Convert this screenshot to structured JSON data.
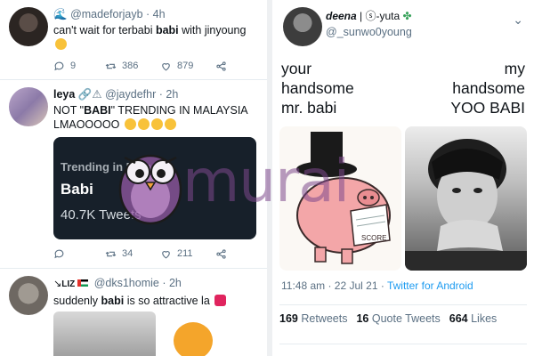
{
  "left_tweets": [
    {
      "name": "",
      "handle": "@madeforjayb · 4h",
      "body_pre": "can't wait for terbabi ",
      "body_bold": "babi",
      "body_post": " with jinyoung",
      "replies": "9",
      "retweets": "386",
      "likes": "879"
    },
    {
      "name": "leya",
      "handle": "@jaydefhr · 2h",
      "body_pre": "NOT \"",
      "body_bold": "BABI",
      "body_post": "\" TRENDING IN MALAYSIA LMAOOOOO",
      "trend_title": "Trending in Malaysia",
      "trend_word": "Babi",
      "trend_count": "40.7K Tweets",
      "retweets": "34",
      "likes": "211"
    },
    {
      "name": "LIZ",
      "handle": "@dks1homie · 2h",
      "body_pre": "suddenly ",
      "body_bold": "babi",
      "body_post": " is so attractive la"
    }
  ],
  "right_tweet": {
    "name": "deena",
    "name_suffix": "| ⓢ-yuta",
    "handle": "@_sunwo0young",
    "text_left_1": "your",
    "text_left_2": "handsome",
    "text_left_3": "mr. babi",
    "text_right_1": "my",
    "text_right_2": "handsome",
    "text_right_3": "YOO BABI",
    "score_label": "SCORE",
    "time": "11:48 am · 22 Jul 21 · ",
    "client": "Twitter for Android",
    "retweets_count": "169",
    "retweets_label": "Retweets",
    "quotes_count": "16",
    "quotes_label": "Quote Tweets",
    "likes_count": "664",
    "likes_label": "Likes"
  },
  "watermark": "murai",
  "colors": {
    "link": "#1d9bf0",
    "muted": "#5b7083",
    "watermark": "#7e498c",
    "card_bg": "#17202a"
  }
}
